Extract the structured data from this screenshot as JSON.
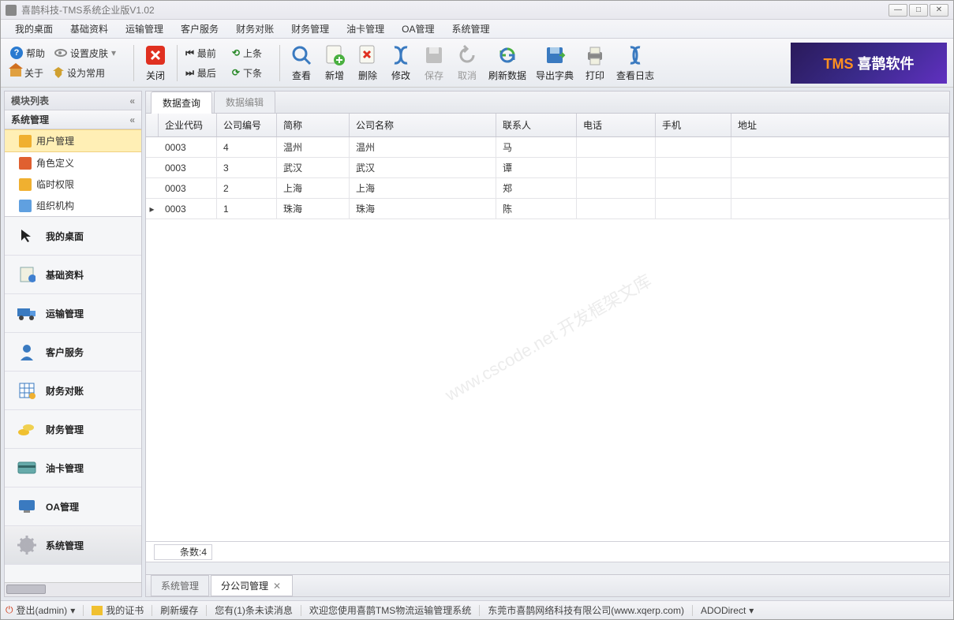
{
  "window": {
    "title": "喜鹊科技-TMS系统企业版V1.02"
  },
  "menubar": [
    "我的桌面",
    "基础资料",
    "运输管理",
    "客户服务",
    "财务对账",
    "财务管理",
    "油卡管理",
    "OA管理",
    "系统管理"
  ],
  "toolbar_small": {
    "help": "帮助",
    "skin": "设置皮肤",
    "about": "关于",
    "setdefault": "设为常用"
  },
  "toolbar_close": {
    "close": "关闭"
  },
  "toolbar_nav": {
    "first": "最前",
    "last": "最后",
    "prev": "上条",
    "next": "下条"
  },
  "toolbar_big": {
    "view": "查看",
    "add": "新增",
    "delete": "删除",
    "edit": "修改",
    "save": "保存",
    "cancel": "取消",
    "refresh": "刷新数据",
    "export": "导出字典",
    "print": "打印",
    "log": "查看日志"
  },
  "logo": {
    "brand": "TMS",
    "suffix": " 喜鹊软件"
  },
  "sidebar": {
    "header": "模块列表",
    "section": "系统管理",
    "tree": [
      "用户管理",
      "角色定义",
      "临时权限",
      "组织机构"
    ],
    "nav": [
      "我的桌面",
      "基础资料",
      "运输管理",
      "客户服务",
      "财务对账",
      "财务管理",
      "油卡管理",
      "OA管理",
      "系统管理"
    ]
  },
  "tabs": {
    "query": "数据查询",
    "edit": "数据编辑"
  },
  "grid": {
    "columns": [
      "企业代码",
      "公司编号",
      "简称",
      "公司名称",
      "联系人",
      "电话",
      "手机",
      "地址"
    ],
    "rows": [
      {
        "code": "0003",
        "no": "1",
        "short": "珠海",
        "name": "珠海",
        "contact": "陈",
        "tel": "",
        "mobile": "",
        "addr": ""
      },
      {
        "code": "0003",
        "no": "2",
        "short": "上海",
        "name": "上海",
        "contact": "郑",
        "tel": "",
        "mobile": "",
        "addr": ""
      },
      {
        "code": "0003",
        "no": "3",
        "short": "武汉",
        "name": "武汉",
        "contact": "谭",
        "tel": "",
        "mobile": "",
        "addr": ""
      },
      {
        "code": "0003",
        "no": "4",
        "short": "温州",
        "name": "温州",
        "contact": "马",
        "tel": "",
        "mobile": "",
        "addr": ""
      }
    ],
    "footer": "条数:4"
  },
  "watermark": "www.cscode.net\n开发框架文库",
  "bottom_tabs": {
    "sys": "系统管理",
    "branch": "分公司管理"
  },
  "status": {
    "logout": "登出(admin)",
    "cert": "我的证书",
    "refresh": "刷新缓存",
    "unread": "您有(1)条未读消息",
    "welcome": "欢迎您使用喜鹊TMS物流运输管理系统",
    "company": "东莞市喜鹊网络科技有限公司(www.xqerp.com)",
    "mode": "ADODirect"
  }
}
